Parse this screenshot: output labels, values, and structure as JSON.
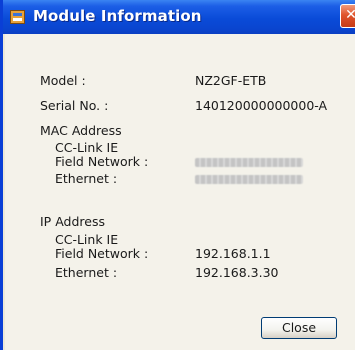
{
  "window": {
    "title": "Module Information",
    "close_glyph": "✕"
  },
  "fields": {
    "model_label": "Model :",
    "model_value": "NZ2GF-ETB",
    "serial_label": "Serial No. :",
    "serial_value": "140120000000000-A",
    "mac_heading": "MAC Address",
    "mac_cclink_line1": "CC-Link IE",
    "mac_cclink_line2": "Field Network :",
    "mac_ethernet_label": "Ethernet :",
    "ip_heading": "IP Address",
    "ip_cclink_line1": "CC-Link IE",
    "ip_cclink_line2": "Field Network :",
    "ip_cclink_value": "192.168.1.1",
    "ip_ethernet_label": "Ethernet :",
    "ip_ethernet_value": "192.168.3.30"
  },
  "buttons": {
    "close_label": "Close"
  },
  "colors": {
    "titlebar": "#0a4bd8",
    "close_x": "#e0542c",
    "panel": "#f4f2ea"
  },
  "icons": {
    "title": "module-info-icon",
    "close": "close-icon"
  }
}
